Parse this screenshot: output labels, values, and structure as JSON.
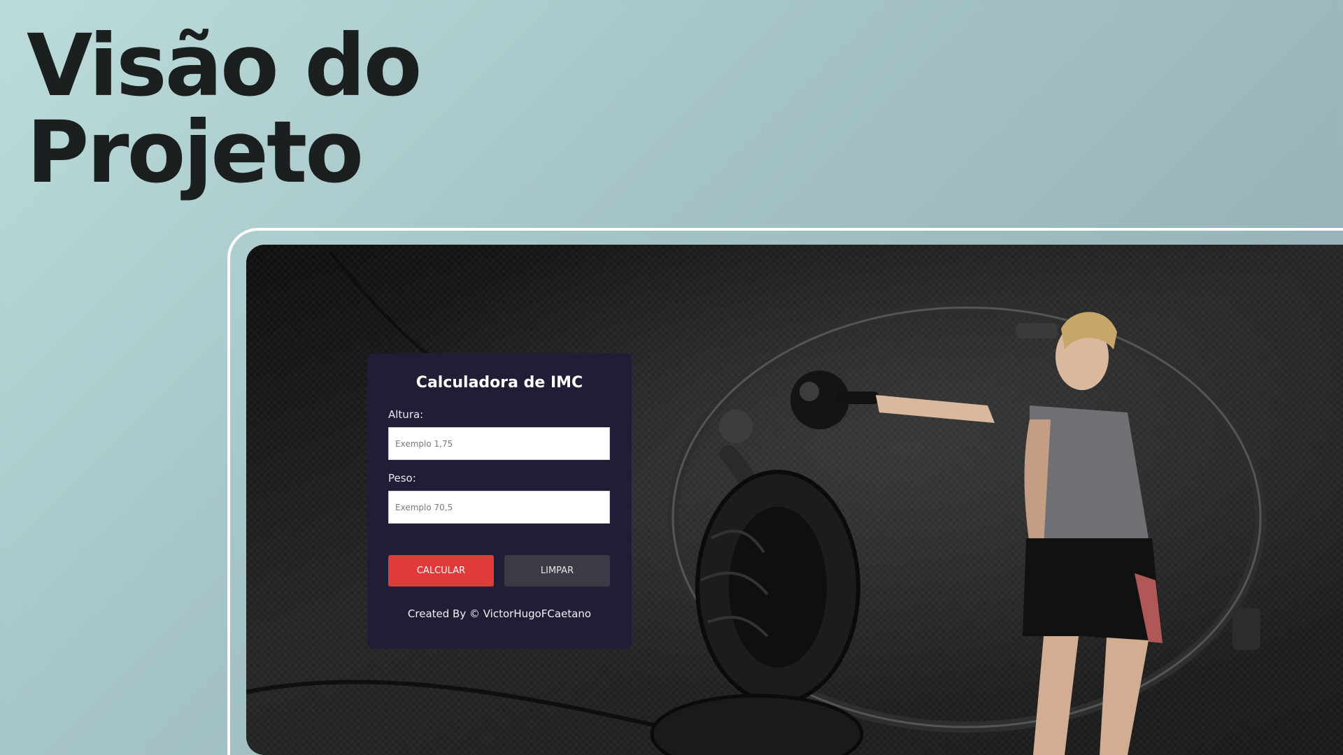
{
  "slide": {
    "title_line1": "Visão do",
    "title_line2": "Projeto"
  },
  "app": {
    "card_title": "Calculadora de IMC",
    "height_field": {
      "label": "Altura:",
      "placeholder": "Exemplo 1,75",
      "value": ""
    },
    "weight_field": {
      "label": "Peso:",
      "placeholder": "Exemplo 70,5",
      "value": ""
    },
    "buttons": {
      "calculate_label": "CALCULAR",
      "clear_label": "LIMPAR"
    },
    "credit": "Created By © VictorHugoFCaetano"
  },
  "colors": {
    "slide_background": "#a7c6c8",
    "title_text": "#1c1f1f",
    "card_background": "#1f1e36",
    "calculate_button": "#e03a3a",
    "clear_button": "#3b3b45",
    "frame_border": "#ffffff"
  },
  "hero_image": {
    "description_icon": "fitness-woman-kettlebell-image"
  }
}
